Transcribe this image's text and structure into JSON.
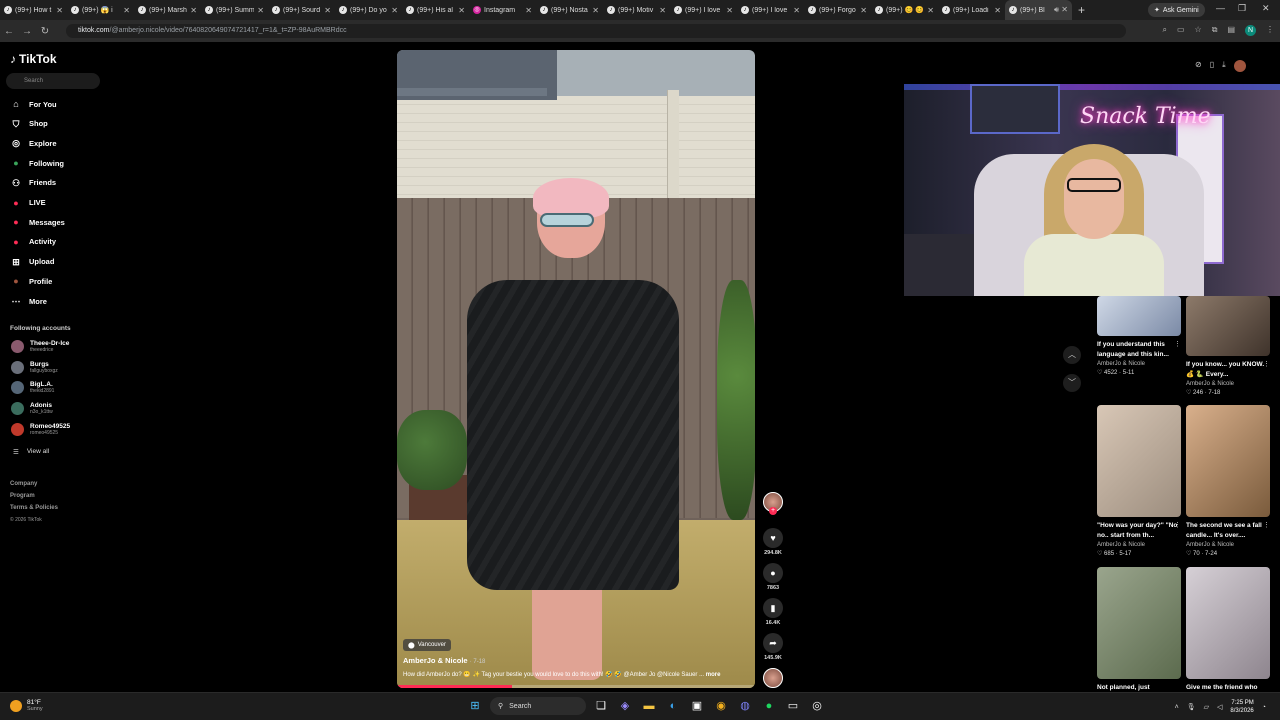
{
  "browser": {
    "tabs": [
      {
        "label": "(99+) How t",
        "icon": "tiktok-icon"
      },
      {
        "label": "(99+) 😱 i",
        "icon": "tiktok-icon"
      },
      {
        "label": "(99+) Marsh",
        "icon": "tiktok-icon"
      },
      {
        "label": "(99+) Summ",
        "icon": "tiktok-icon"
      },
      {
        "label": "(99+) Sourd",
        "icon": "tiktok-icon"
      },
      {
        "label": "(99+) Do yo",
        "icon": "tiktok-icon"
      },
      {
        "label": "(99+) His al",
        "icon": "tiktok-icon"
      },
      {
        "label": "Instagram",
        "icon": "instagram-icon"
      },
      {
        "label": "(99+) Nosta",
        "icon": "tiktok-icon"
      },
      {
        "label": "(99+) Motiv",
        "icon": "tiktok-icon"
      },
      {
        "label": "(99+) I love",
        "icon": "tiktok-icon"
      },
      {
        "label": "(99+) I love",
        "icon": "tiktok-icon"
      },
      {
        "label": "(99+) Forgo",
        "icon": "tiktok-icon"
      },
      {
        "label": "(99+) 😊 😊",
        "icon": "tiktok-icon"
      },
      {
        "label": "(99+) Loadi",
        "icon": "tiktok-icon"
      },
      {
        "label": "(99+) Bl",
        "icon": "tiktok-icon",
        "active": true
      }
    ],
    "ask_gemini": "Ask Gemini",
    "url_host": "tiktok.com",
    "url_path": "/@amberjo.nicole/video/7640820649074721417_r=1&_t=ZP-98AuRMBRdcc"
  },
  "sidebar": {
    "logo": "TikTok",
    "search_placeholder": "Search",
    "nav": [
      {
        "label": "For You",
        "icon": "home-icon"
      },
      {
        "label": "Shop",
        "icon": "shop-icon"
      },
      {
        "label": "Explore",
        "icon": "compass-icon"
      },
      {
        "label": "Following",
        "icon": "following-icon"
      },
      {
        "label": "Friends",
        "icon": "friends-icon"
      },
      {
        "label": "LIVE",
        "icon": "live-icon"
      },
      {
        "label": "Messages",
        "icon": "messages-icon"
      },
      {
        "label": "Activity",
        "icon": "activity-icon"
      },
      {
        "label": "Upload",
        "icon": "upload-icon"
      },
      {
        "label": "Profile",
        "icon": "profile-icon"
      },
      {
        "label": "More",
        "icon": "more-icon"
      }
    ],
    "following_title": "Following accounts",
    "following": [
      {
        "name": "Theee-Dr-Ice",
        "handle": "theeedrice"
      },
      {
        "name": "Burgs",
        "handle": "fallguyboxgz"
      },
      {
        "name": "BigL.A.",
        "handle": "thekid2891"
      },
      {
        "name": "Adonis",
        "handle": "n3o_k1ttw"
      },
      {
        "name": "Romeo49525",
        "handle": "romeo49525"
      }
    ],
    "view_all": "View all",
    "footer": [
      "Company",
      "Program",
      "Terms & Policies"
    ],
    "copyright": "© 2026 TikTok"
  },
  "video": {
    "location": "Vancouver",
    "author": "AmberJo & Nicole",
    "date": "· 7-18",
    "caption": "How did AmberJo do? 😬 ✨ Tag your bestie you would love to do this with! 🤣 🤣 @Amber Jo @Nicole Sauer ...",
    "more": "more",
    "progress": 0.32
  },
  "actions": {
    "likes": "294.8K",
    "comments": "7863",
    "saves": "16.4K",
    "shares": "145.9K"
  },
  "grid": [
    {
      "title": "If you understand this language and this kin...",
      "author": "AmberJo & Nicole",
      "stats": "♡ 4522 · 5-11"
    },
    {
      "title": "If you know... you KNOW. 💰 🐍 Every...",
      "author": "AmberJo & Nicole",
      "stats": "♡ 246 · 7-18"
    },
    {
      "title": "\"How was your day?\" \"No no.. start from th...",
      "author": "AmberJo & Nicole",
      "stats": "♡ 685 · 5-17"
    },
    {
      "title": "The second we see a fall candle... It's over....",
      "author": "AmberJo & Nicole",
      "stats": "♡ 70 · 7-24"
    },
    {
      "title": "Not planned, just",
      "author": "",
      "stats": ""
    },
    {
      "title": "Give me the friend who",
      "author": "",
      "stats": ""
    }
  ],
  "webcam": {
    "neon_text": "Snack Time"
  },
  "taskbar": {
    "temp": "81°F",
    "condition": "Sunny",
    "search": "Search",
    "time": "7:25 PM",
    "date": "8/3/2026"
  }
}
